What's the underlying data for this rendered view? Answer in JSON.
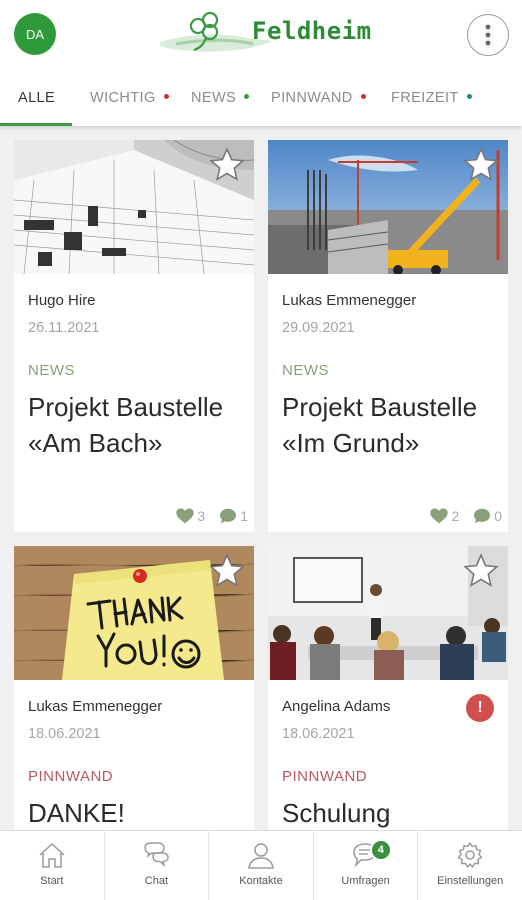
{
  "header": {
    "avatar_initials": "DA",
    "logo_text": "Feldheim"
  },
  "tabs": [
    {
      "label": "ALLE",
      "active": true
    },
    {
      "label": "WICHTIG",
      "dot_color": "#c8303a"
    },
    {
      "label": "NEWS",
      "dot_color": "#3c9a44"
    },
    {
      "label": "PINNWAND",
      "dot_color": "#c8303a"
    },
    {
      "label": "FREIZEIT",
      "dot_color": "#1e8a8a"
    }
  ],
  "posts": [
    {
      "author": "Hugo Hire",
      "date": "26.11.2021",
      "category": "NEWS",
      "category_color": "#8aa07a",
      "title": "Projekt Baustelle «Am Bach»",
      "likes": "3",
      "comments": "1",
      "image": "construction-plan"
    },
    {
      "author": "Lukas Emmenegger",
      "date": "29.09.2021",
      "category": "NEWS",
      "category_color": "#8aa07a",
      "title": "Projekt Baustelle «Im Grund»",
      "likes": "2",
      "comments": "0",
      "image": "construction-site"
    },
    {
      "author": "Lukas Emmenegger",
      "date": "18.06.2021",
      "category": "PINNWAND",
      "category_color": "#b85a62",
      "title": "DANKE!",
      "image": "thank-you-note"
    },
    {
      "author": "Angelina Adams",
      "date": "18.06.2021",
      "category": "PINNWAND",
      "category_color": "#b85a62",
      "title": "Schulung",
      "alert": "!",
      "image": "training-room"
    }
  ],
  "bottom_nav": [
    {
      "label": "Start",
      "icon": "home-icon"
    },
    {
      "label": "Chat",
      "icon": "chat-icon"
    },
    {
      "label": "Kontakte",
      "icon": "person-icon"
    },
    {
      "label": "Umfragen",
      "icon": "poll-icon",
      "badge": "4"
    },
    {
      "label": "Einstellungen",
      "icon": "gear-icon"
    }
  ],
  "colors": {
    "accent": "#2e8b35",
    "like": "#8aa07a",
    "alert": "#d05050"
  }
}
